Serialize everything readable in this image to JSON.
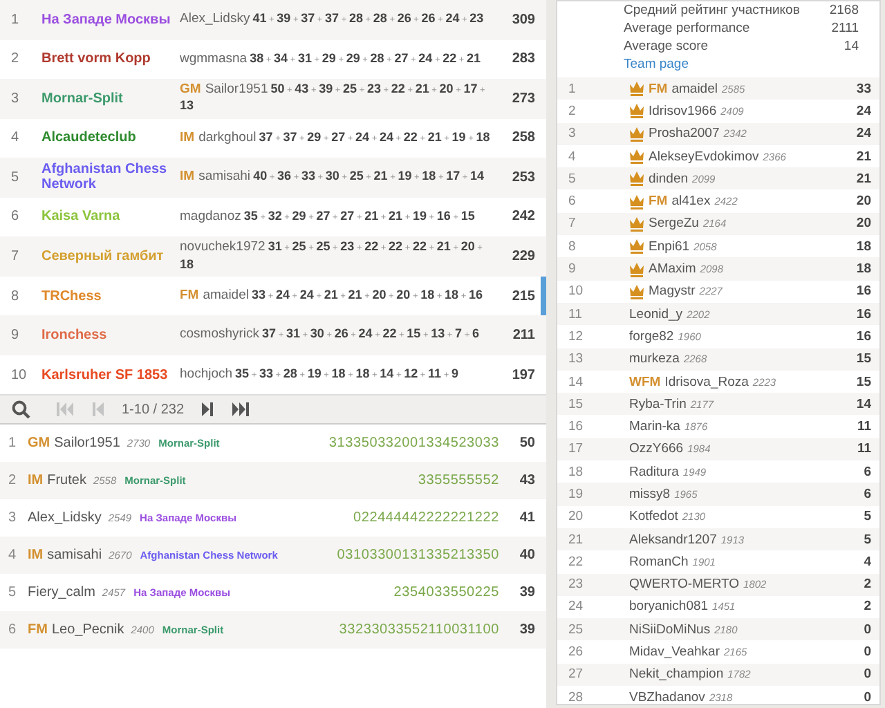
{
  "teams": [
    {
      "rank": "1",
      "name": "На Западе Москвы",
      "color": "#9b4fe0",
      "selected": false,
      "player": {
        "name": "Alex_Lidsky"
      },
      "scores": "**41** + **39** + **37** + **37** + **28** + **28** + **26** + **26** + **24** + **23**",
      "total": "309"
    },
    {
      "rank": "2",
      "name": "Brett vorm Kopp",
      "color": "#b03a2e",
      "selected": false,
      "player": {
        "name": "wgmmasna"
      },
      "scores": "**38** + **34** + **31** + **29** + **29** + **28** + **27** + **24** + **22** + **21**",
      "total": "283"
    },
    {
      "rank": "3",
      "name": "Mornar-Split",
      "color": "#3c9a6c",
      "selected": false,
      "player": {
        "title": "GM",
        "name": "Sailor1951"
      },
      "scores": "**50** + **43** + **39** + **25** + **23** + **22** + **21** + **20** + **17** + **13**",
      "total": "273"
    },
    {
      "rank": "4",
      "name": "Alcaudeteclub",
      "color": "#2e8a2e",
      "selected": false,
      "player": {
        "title": "IM",
        "name": "darkghoul"
      },
      "scores": "**37** + **37** + **29** + **27** + **24** + **24** + **22** + **21** + **19** + **18**",
      "total": "258"
    },
    {
      "rank": "5",
      "name": "Afghanistan Chess Network",
      "color": "#6a5cf0",
      "selected": false,
      "player": {
        "title": "IM",
        "name": "samisahi"
      },
      "scores": "**40** + **36** + **33** + **30** + **25** + **21** + **19** + **18** + **17** + **14**",
      "total": "253"
    },
    {
      "rank": "6",
      "name": "Kaisa Varna",
      "color": "#8cc43c",
      "selected": false,
      "player": {
        "name": "magdanoz"
      },
      "scores": "**35** + **32** + **29** + **27** + **27** + **21** + **21** + **19** + **16** + **15**",
      "total": "242"
    },
    {
      "rank": "7",
      "name": "Северный гамбит",
      "color": "#d4a030",
      "selected": false,
      "player": {
        "name": "novuchek1972"
      },
      "scores": "**31** + **25** + **25** + **23** + **22** + **22** + **22** + **21** + **20** + **18**",
      "total": "229"
    },
    {
      "rank": "8",
      "name": "TRChess",
      "color": "#e0882a",
      "selected": true,
      "player": {
        "title": "FM",
        "name": "amaidel"
      },
      "scores": "**33** + **24** + **24** + **21** + **21** + **20** + **20** + **18** + **18** + **16**",
      "total": "215"
    },
    {
      "rank": "9",
      "name": "Ironchess",
      "color": "#e06a48",
      "selected": false,
      "player": {
        "name": "cosmoshyrick"
      },
      "scores": "**37** + **31** + **30** + **26** + **24** + **22** + **15** + **13** + **7** + **6**",
      "total": "211"
    },
    {
      "rank": "10",
      "name": "Karlsruher SF 1853",
      "color": "#e84a22",
      "selected": false,
      "player": {
        "name": "hochjoch"
      },
      "scores": "**35** + **33** + **28** + **19** + **18** + **18** + **14** + **12** + **11** + **9**",
      "total": "197"
    }
  ],
  "pager": [
    {
      "kind": "search",
      "disabled": false
    },
    {
      "kind": "first",
      "disabled": true
    },
    {
      "kind": "prev",
      "disabled": true
    },
    {
      "kind": "label",
      "text": "1-10 / 232"
    },
    {
      "kind": "next",
      "disabled": false
    },
    {
      "kind": "last",
      "disabled": false
    }
  ],
  "players": [
    {
      "rank": "1",
      "title": "GM",
      "name": "Sailor1951",
      "rating": "2730",
      "team": "Mornar-Split",
      "color": "#3c9a6c",
      "sheet": "313350332001334523033",
      "score": "50"
    },
    {
      "rank": "2",
      "title": "IM",
      "name": "Frutek",
      "rating": "2558",
      "team": "Mornar-Split",
      "color": "#3c9a6c",
      "sheet": "3355555552",
      "score": "43"
    },
    {
      "rank": "3",
      "name": "Alex_Lidsky",
      "rating": "2549",
      "team": "На Западе Москвы",
      "color": "#9b4fe0",
      "sheet": "022444442222221222",
      "score": "41"
    },
    {
      "rank": "4",
      "title": "IM",
      "name": "samisahi",
      "rating": "2670",
      "team": "Afghanistan Chess Network",
      "color": "#6a5cf0",
      "sheet": "03103300131335213350",
      "score": "40"
    },
    {
      "rank": "5",
      "name": "Fiery_calm",
      "rating": "2457",
      "team": "На Западе Москвы",
      "color": "#9b4fe0",
      "sheet": "2354033550225",
      "score": "39"
    },
    {
      "rank": "6",
      "title": "FM",
      "name": "Leo_Pecnik",
      "rating": "2400",
      "team": "Mornar-Split",
      "color": "#3c9a6c",
      "sheet": "33233033552110031100",
      "score": "39"
    }
  ],
  "team_info": {
    "stats": [
      {
        "label": "Средний рейтинг участников",
        "value": "2168"
      },
      {
        "label": "Average performance",
        "value": "2111"
      },
      {
        "label": "Average score",
        "value": "14"
      }
    ],
    "link": "Team page"
  },
  "members": [
    {
      "rank": "1",
      "crown": true,
      "title": "FM",
      "name": "amaidel",
      "rating": "2585",
      "score": "33"
    },
    {
      "rank": "2",
      "crown": true,
      "name": "Idrisov1966",
      "rating": "2409",
      "score": "24"
    },
    {
      "rank": "3",
      "crown": true,
      "name": "Prosha2007",
      "rating": "2342",
      "score": "24"
    },
    {
      "rank": "4",
      "crown": true,
      "name": "AlekseyEvdokimov",
      "rating": "2366",
      "score": "21"
    },
    {
      "rank": "5",
      "crown": true,
      "name": "dinden",
      "rating": "2099",
      "score": "21"
    },
    {
      "rank": "6",
      "crown": true,
      "title": "FM",
      "name": "al41ex",
      "rating": "2422",
      "score": "20"
    },
    {
      "rank": "7",
      "crown": true,
      "name": "SergeZu",
      "rating": "2164",
      "score": "20"
    },
    {
      "rank": "8",
      "crown": true,
      "name": "Enpi61",
      "rating": "2058",
      "score": "18"
    },
    {
      "rank": "9",
      "crown": true,
      "name": "AMaxim",
      "rating": "2098",
      "score": "18"
    },
    {
      "rank": "10",
      "crown": true,
      "name": "Magystr",
      "rating": "2227",
      "score": "16"
    },
    {
      "rank": "11",
      "crown": false,
      "name": "Leonid_y",
      "rating": "2202",
      "score": "16"
    },
    {
      "rank": "12",
      "crown": false,
      "name": "forge82",
      "rating": "1960",
      "score": "16"
    },
    {
      "rank": "13",
      "crown": false,
      "name": "murkeza",
      "rating": "2268",
      "score": "15"
    },
    {
      "rank": "14",
      "crown": false,
      "title": "WFM",
      "name": "Idrisova_Roza",
      "rating": "2223",
      "score": "15"
    },
    {
      "rank": "15",
      "crown": false,
      "name": "Ryba-Trin",
      "rating": "2177",
      "score": "14"
    },
    {
      "rank": "16",
      "crown": false,
      "name": "Marin-ka",
      "rating": "1876",
      "score": "11"
    },
    {
      "rank": "17",
      "crown": false,
      "name": "OzzY666",
      "rating": "1984",
      "score": "11"
    },
    {
      "rank": "18",
      "crown": false,
      "name": "Raditura",
      "rating": "1949",
      "score": "6"
    },
    {
      "rank": "19",
      "crown": false,
      "name": "missy8",
      "rating": "1965",
      "score": "6"
    },
    {
      "rank": "20",
      "crown": false,
      "name": "Kotfedot",
      "rating": "2130",
      "score": "5"
    },
    {
      "rank": "21",
      "crown": false,
      "name": "Aleksandr1207",
      "rating": "1913",
      "score": "5"
    },
    {
      "rank": "22",
      "crown": false,
      "name": "RomanCh",
      "rating": "1901",
      "score": "4"
    },
    {
      "rank": "23",
      "crown": false,
      "name": "QWERTO-MERTO",
      "rating": "1802",
      "score": "2"
    },
    {
      "rank": "24",
      "crown": false,
      "name": "boryanich081",
      "rating": "1451",
      "score": "2"
    },
    {
      "rank": "25",
      "crown": false,
      "name": "NiSiiDoMiNus",
      "rating": "2180",
      "score": "0"
    },
    {
      "rank": "26",
      "crown": false,
      "name": "Midav_Veahkar",
      "rating": "2165",
      "score": "0"
    },
    {
      "rank": "27",
      "crown": false,
      "name": "Nekit_champion",
      "rating": "1782",
      "score": "0"
    },
    {
      "rank": "28",
      "crown": false,
      "name": "VBZhadanov",
      "rating": "2318",
      "score": "0"
    }
  ]
}
